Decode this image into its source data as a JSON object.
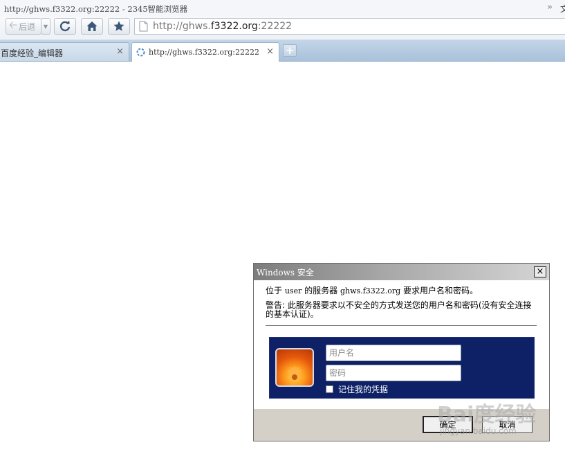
{
  "window": {
    "title": "http://ghws.f3322.org:22222 - 2345智能浏览器",
    "more_glyph": "»",
    "edge_text": "文"
  },
  "toolbar": {
    "back_label": "后退",
    "back_icon": "arrow-left-icon",
    "dropdown_icon": "chevron-down-icon",
    "refresh_icon": "refresh-icon",
    "home_icon": "home-icon",
    "favorite_icon": "star-icon",
    "address": {
      "prefix": "http://ghws.",
      "domain": "f3322.org",
      "suffix": ":22222"
    }
  },
  "tabs": [
    {
      "label": "百度经验_编辑器",
      "close": "×",
      "active": false
    },
    {
      "label": "http://ghws.f3322.org:22222",
      "close": "×",
      "active": true,
      "loading": true
    }
  ],
  "new_tab_label": "+",
  "dialog": {
    "title": "Windows 安全",
    "close_glyph": "×",
    "line1_a": "位于",
    "line1_user": "user",
    "line1_b": "的服务器",
    "line1_server": "ghws.f3322.org",
    "line1_c": "要求用户名和密码。",
    "warning": "警告: 此服务器要求以不安全的方式发送您的用户名和密码(没有安全连接的基本认证)。",
    "username_placeholder": "用户名",
    "password_placeholder": "密码",
    "remember_label": "记住我的凭据",
    "remember_checked": false,
    "ok_label": "确定",
    "cancel_label": "取消",
    "panel_color": "#0e2167"
  },
  "watermark": {
    "brand": "Bai度经验",
    "url": "jingyan.baidu.com"
  }
}
